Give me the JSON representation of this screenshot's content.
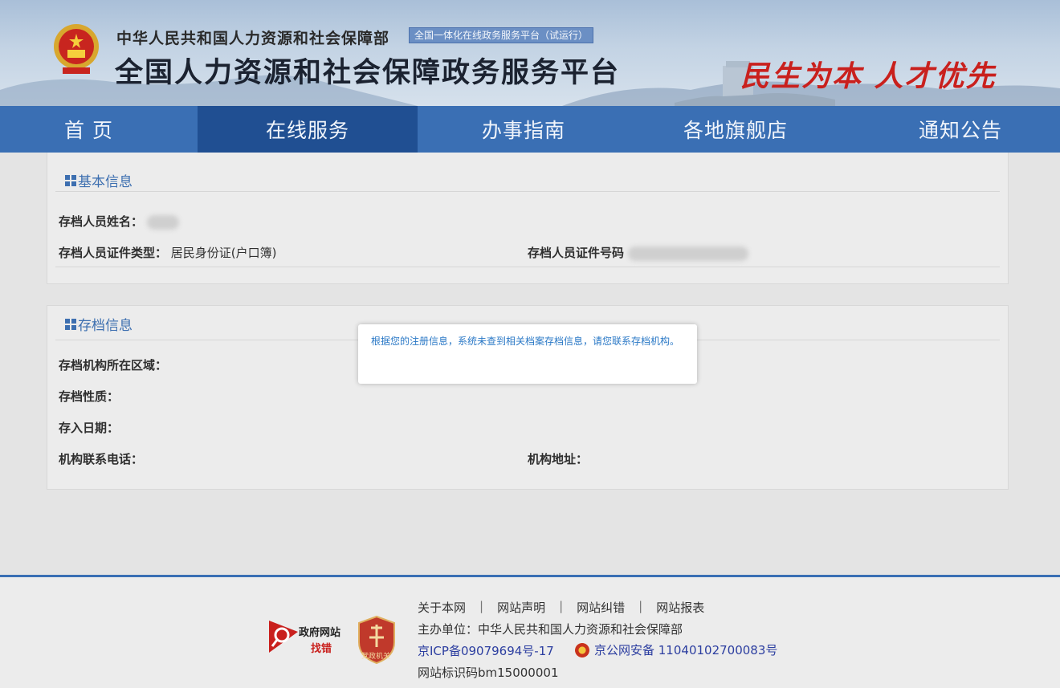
{
  "header": {
    "ministry": "中华人民共和国人力资源和社会保障部",
    "badge": "全国一体化在线政务服务平台（试运行）",
    "platform_title": "全国人力资源和社会保障政务服务平台",
    "slogan": "民生为本 人才优先"
  },
  "nav": {
    "items": [
      {
        "label": "首 页"
      },
      {
        "label": "在线服务"
      },
      {
        "label": "办事指南"
      },
      {
        "label": "各地旗舰店"
      },
      {
        "label": "通知公告"
      }
    ],
    "active": "在线服务"
  },
  "basic_info": {
    "title": "基本信息",
    "name_label": "存档人员姓名：",
    "id_type_label": "存档人员证件类型：",
    "id_type_value": "居民身份证(户口簿)",
    "id_number_label": "存档人员证件号码"
  },
  "archive_info": {
    "title": "存档信息",
    "region_label": "存档机构所在区域：",
    "nature_label": "存档性质：",
    "date_label": "存入日期：",
    "phone_label": "机构联系电话：",
    "address_label": "机构地址："
  },
  "modal": {
    "message": "根据您的注册信息，系统未查到相关档案存档信息，请您联系存档机构。"
  },
  "footer": {
    "links": [
      "关于本网",
      "网站声明",
      "网站纠错",
      "网站报表"
    ],
    "host": "主办单位：中华人民共和国人力资源和社会保障部",
    "icp": "京ICP备09079694号-17",
    "police": "京公网安备 11040102700083号",
    "site_id": "网站标识码bm15000001",
    "gov_logo_line1": "政府网站",
    "gov_logo_line2": "找错",
    "party_logo_text": "党政机关"
  },
  "colors": {
    "nav_bg": "#3a6fb4",
    "nav_active": "#204f92",
    "slogan": "#c9201d",
    "title_blue": "#3d6fb0",
    "modal_text": "#2a78c6"
  }
}
